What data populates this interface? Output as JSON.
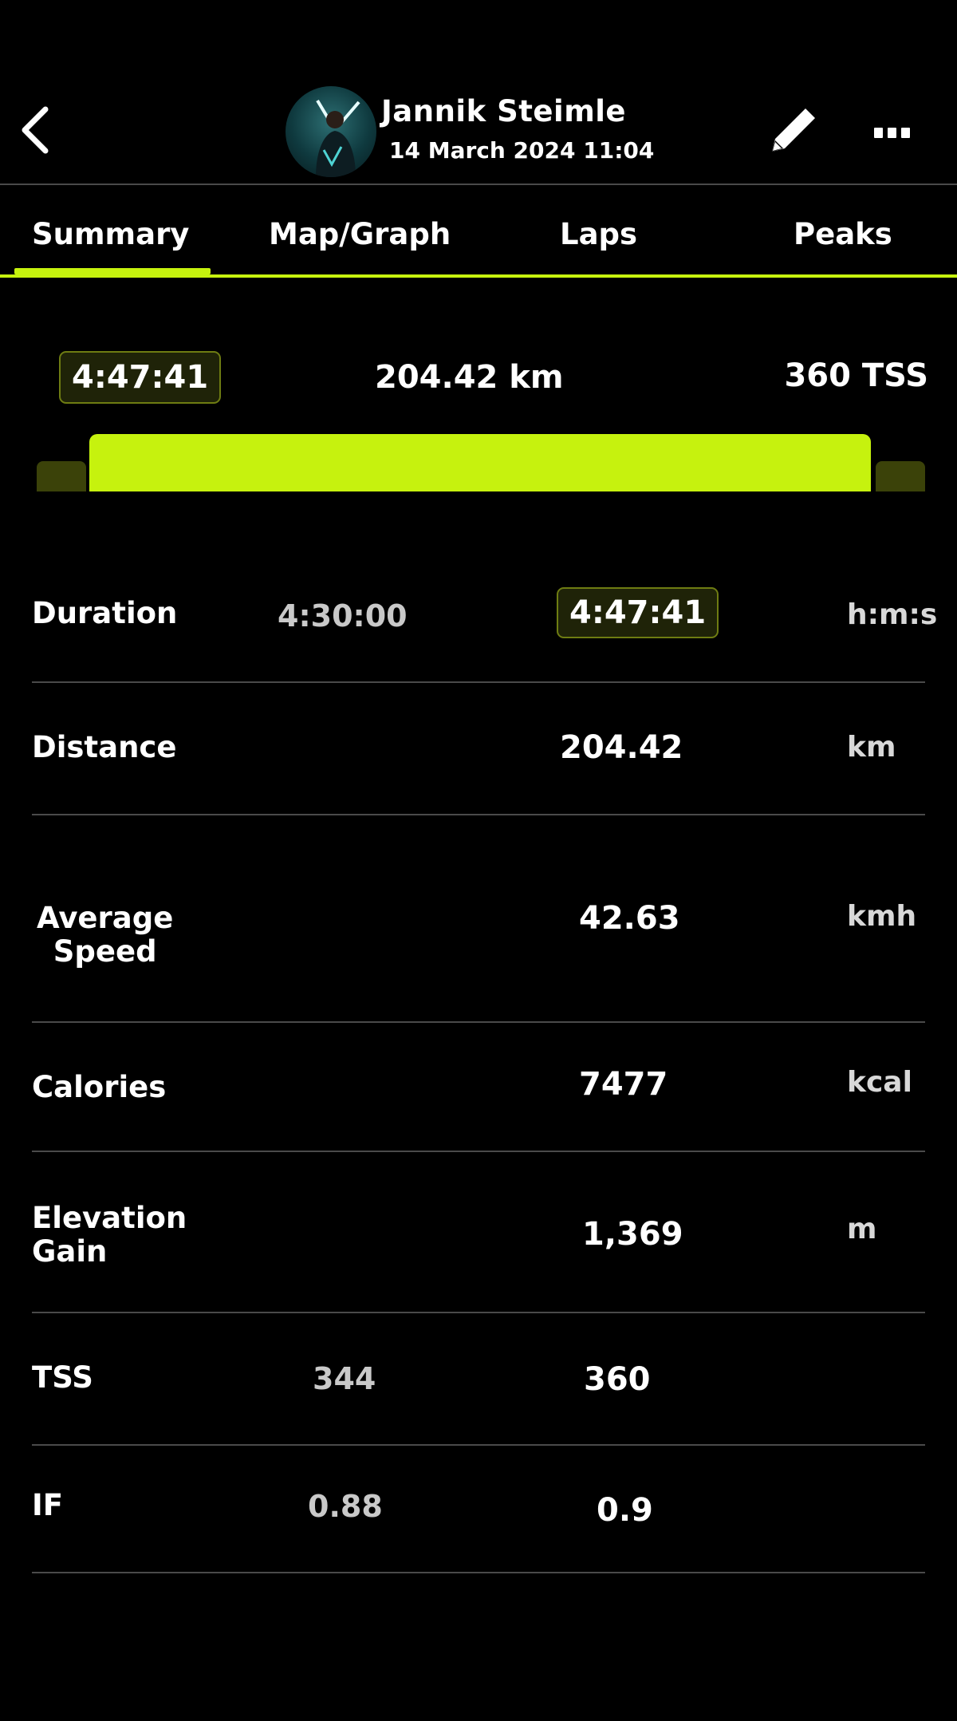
{
  "header": {
    "user_name": "Jannik Steimle",
    "date": "14 March 2024 11:04"
  },
  "tabs": [
    {
      "label": "Summary",
      "active": true
    },
    {
      "label": "Map/Graph",
      "active": false
    },
    {
      "label": "Laps",
      "active": false
    },
    {
      "label": "Peaks",
      "active": false
    }
  ],
  "summary": {
    "duration": "4:47:41",
    "distance": "204.42 km",
    "tss": "360 TSS"
  },
  "metrics": [
    {
      "label": "Duration",
      "planned": "4:30:00",
      "actual": "4:47:41",
      "unit": "h:m:s"
    },
    {
      "label": "Distance",
      "planned": "",
      "actual": "204.42",
      "unit": "km"
    },
    {
      "label": "Average\nSpeed",
      "planned": "",
      "actual": "42.63",
      "unit": "kmh"
    },
    {
      "label": "Calories",
      "planned": "",
      "actual": "7477",
      "unit": "kcal"
    },
    {
      "label": "Elevation\nGain",
      "planned": "",
      "actual": "1,369",
      "unit": "m"
    },
    {
      "label": "TSS",
      "planned": "344",
      "actual": "360",
      "unit": ""
    },
    {
      "label": "IF",
      "planned": "0.88",
      "actual": "0.9",
      "unit": ""
    }
  ],
  "colors": {
    "accent": "#c6f20e",
    "accent_dim": "#3b4209",
    "background": "#000000",
    "divider": "#4a4a4a"
  },
  "icons": {
    "back": "chevron-left-icon",
    "edit": "pencil-icon",
    "more": "more-dots-icon"
  }
}
